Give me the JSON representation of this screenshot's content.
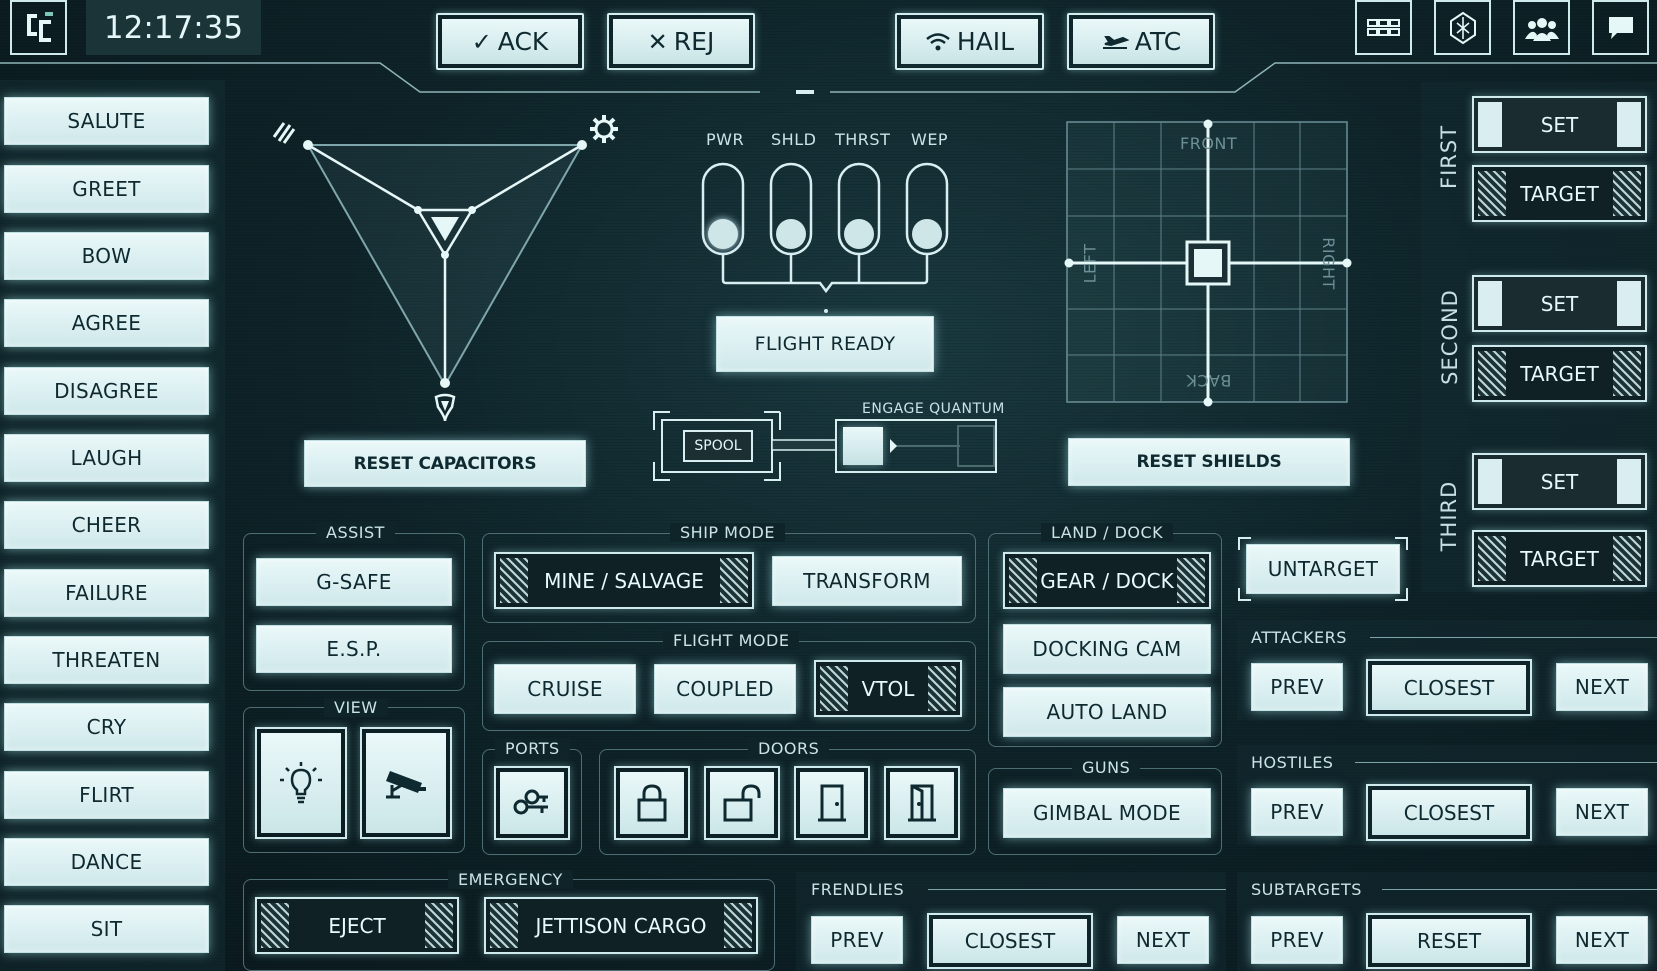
{
  "header": {
    "clock": "12:17:35",
    "ack_label": "ACK",
    "rej_label": "REJ",
    "hail_label": "HAIL",
    "atc_label": "ATC"
  },
  "emotes": [
    "SALUTE",
    "GREET",
    "BOW",
    "AGREE",
    "DISAGREE",
    "LAUGH",
    "CHEER",
    "FAILURE",
    "THREATEN",
    "CRY",
    "FLIRT",
    "DANCE",
    "SIT"
  ],
  "capacitors": {
    "reset_label": "RESET CAPACITORS"
  },
  "power": {
    "sliders": [
      "PWR",
      "SHLD",
      "THRST",
      "WEP"
    ],
    "flight_ready_label": "FLIGHT READY",
    "spool_label": "SPOOL",
    "engage_label": "ENGAGE QUANTUM"
  },
  "shields": {
    "front": "FRONT",
    "back": "BACK",
    "left": "LEFT",
    "right": "RIGHT",
    "reset_label": "RESET SHIELDS"
  },
  "targets": {
    "first": "FIRST",
    "second": "SECOND",
    "third": "THIRD",
    "set_label": "SET",
    "target_label": "TARGET",
    "untarget_label": "UNTARGET"
  },
  "assist": {
    "title": "ASSIST",
    "gsafe": "G-SAFE",
    "esp": "E.S.P."
  },
  "view": {
    "title": "VIEW"
  },
  "ship_mode": {
    "title": "SHIP MODE",
    "mine": "MINE / SALVAGE",
    "transform": "TRANSFORM"
  },
  "flight_mode": {
    "title": "FLIGHT MODE",
    "cruise": "CRUISE",
    "coupled": "COUPLED",
    "vtol": "VTOL"
  },
  "ports": {
    "title": "PORTS"
  },
  "doors": {
    "title": "DOORS"
  },
  "land_dock": {
    "title": "LAND / DOCK",
    "gear": "GEAR / DOCK",
    "docking_cam": "DOCKING CAM",
    "auto_land": "AUTO LAND"
  },
  "guns": {
    "title": "GUNS",
    "gimbal": "GIMBAL MODE"
  },
  "emergency": {
    "title": "EMERGENCY",
    "eject": "EJECT",
    "jettison": "JETTISON CARGO"
  },
  "attackers": {
    "title": "ATTACKERS",
    "prev": "PREV",
    "closest": "CLOSEST",
    "next": "NEXT"
  },
  "hostiles": {
    "title": "HOSTILES",
    "prev": "PREV",
    "closest": "CLOSEST",
    "next": "NEXT"
  },
  "friendlies": {
    "title": "FRENDLIES",
    "prev": "PREV",
    "closest": "CLOSEST",
    "next": "NEXT"
  },
  "subtargets": {
    "title": "SUBTARGETS",
    "prev": "PREV",
    "reset": "RESET",
    "next": "NEXT"
  }
}
